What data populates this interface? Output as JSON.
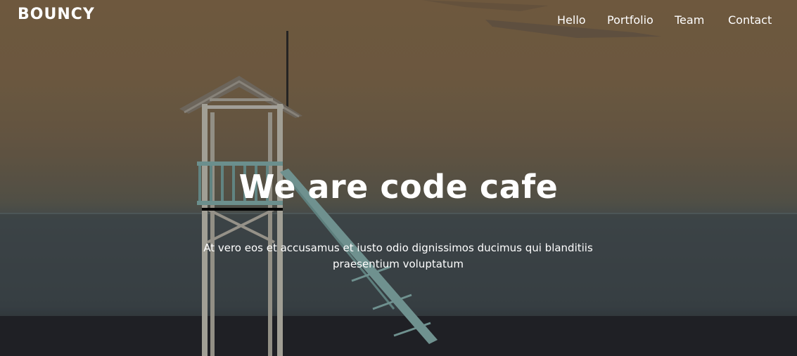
{
  "header": {
    "brand": "BOUNCY",
    "nav": [
      "Hello",
      "Portfolio",
      "Team",
      "Contact"
    ]
  },
  "hero": {
    "title": "We are code cafe",
    "subtitle": "At vero eos et accusamus et iusto odio dignissimos ducimus qui blanditiis praesentium voluptatum"
  }
}
